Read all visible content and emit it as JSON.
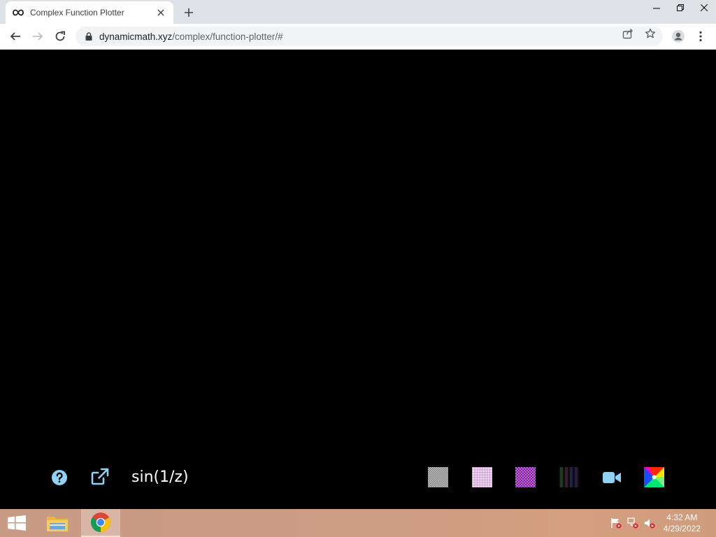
{
  "browser": {
    "tab_title": "Complex Function Plotter",
    "url_domain": "dynamicmath.xyz",
    "url_path": "/complex/function-plotter/#"
  },
  "plotter": {
    "formula": "sin(1/z)",
    "swatches": [
      {
        "name": "checker-gray",
        "color": "#9a9a9a"
      },
      {
        "name": "grid-pink",
        "color": "#e9c9ec"
      },
      {
        "name": "hex-purple",
        "color": "#9c3fb4"
      },
      {
        "name": "stripes-dark",
        "color": "#2a1f33"
      }
    ],
    "accent_color": "#8fd3f4"
  },
  "taskbar": {
    "time": "4:32 AM",
    "date": "4/29/2022"
  }
}
